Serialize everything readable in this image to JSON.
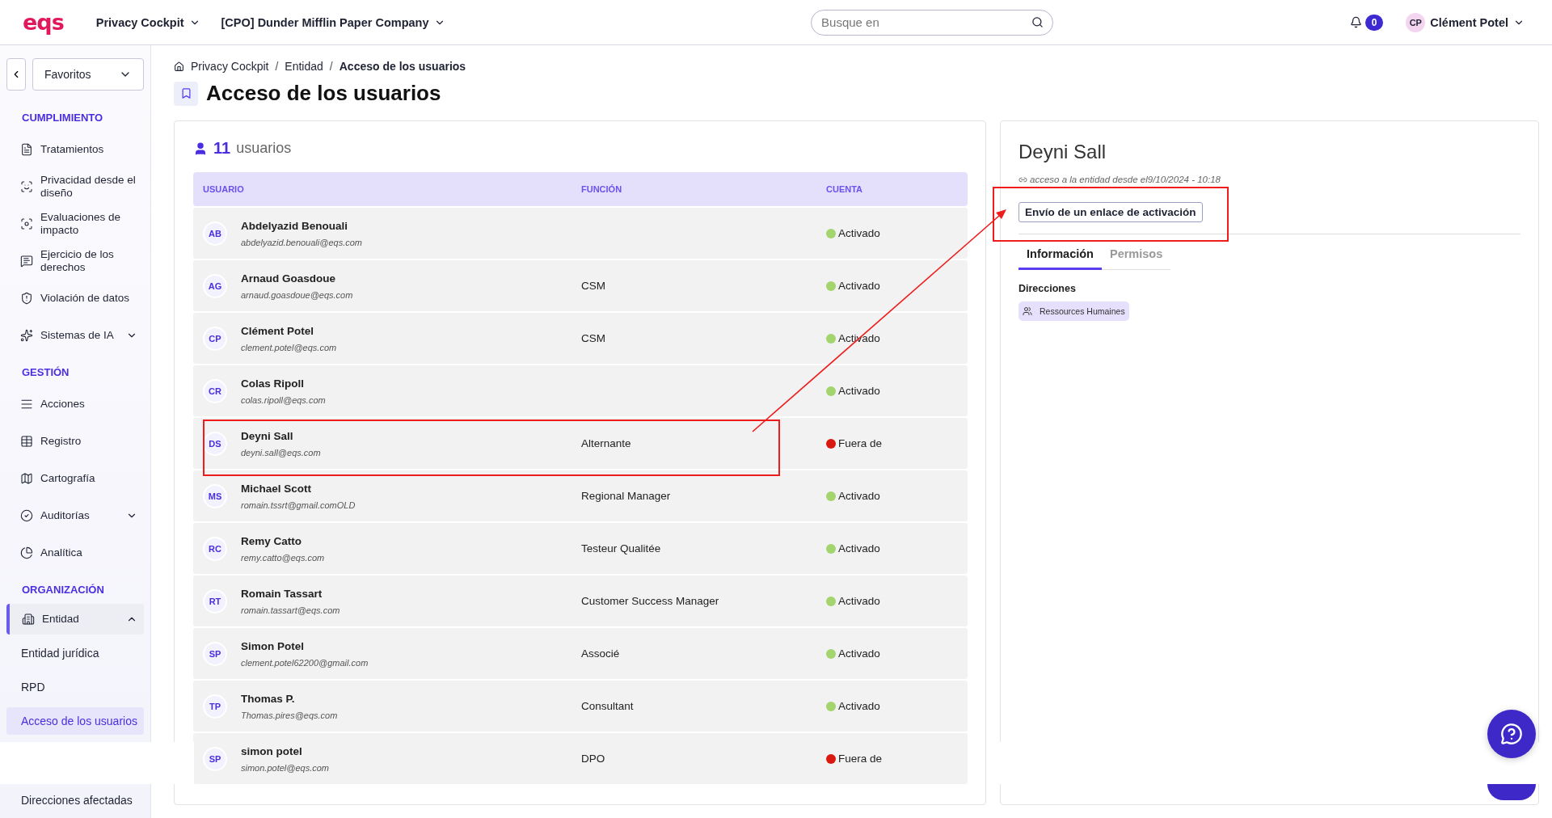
{
  "top_bar": {
    "logo": "eqs",
    "menus": [
      {
        "label": "Privacy Cockpit"
      },
      {
        "label": "[CPO] Dunder Mifflin Paper Company"
      }
    ],
    "search": {
      "placeholder": "Busque en"
    },
    "notifications": "0",
    "user": {
      "initials": "CP",
      "name": "Clément Potel"
    }
  },
  "sidebar": {
    "favorites": "Favoritos",
    "sections": [
      {
        "title": "CUMPLIMIENTO",
        "items": [
          {
            "kind": "link",
            "label": "Tratamientos",
            "selected": false
          },
          {
            "kind": "link",
            "label": "Privacidad desde el diseño",
            "selected": false
          },
          {
            "kind": "link",
            "label": "Evaluaciones de impacto",
            "selected": false
          },
          {
            "kind": "link",
            "label": "Ejercicio de los derechos",
            "selected": false
          },
          {
            "kind": "link",
            "label": "Violación de datos",
            "selected": false
          },
          {
            "kind": "group",
            "label": "Sistemas de IA",
            "selected": false,
            "expanded": false
          }
        ]
      },
      {
        "title": "GESTIÓN",
        "items": [
          {
            "kind": "link",
            "label": "Acciones",
            "selected": false
          },
          {
            "kind": "link",
            "label": "Registro",
            "selected": false
          },
          {
            "kind": "link",
            "label": "Cartografía",
            "selected": false
          },
          {
            "kind": "group",
            "label": "Auditorías",
            "selected": false,
            "expanded": false
          },
          {
            "kind": "link",
            "label": "Analítica",
            "selected": false
          }
        ]
      },
      {
        "title": "ORGANIZACIÓN",
        "items": [
          {
            "kind": "group",
            "label": "Entidad",
            "selected": true,
            "expanded": true,
            "children": [
              {
                "label": "Entidad jurídica",
                "selected": false
              },
              {
                "label": "RPD",
                "selected": false
              },
              {
                "label": "Acceso de los usuarios",
                "selected": true
              },
              {
                "label": "Direcciones afectadas",
                "selected": false
              }
            ]
          }
        ]
      }
    ]
  },
  "breadcrumb": {
    "separator": "/",
    "items": [
      "Privacy Cockpit",
      "Entidad",
      "Acceso de los usuarios"
    ]
  },
  "page_title": "Acceso de los usuarios",
  "users": {
    "count": "11",
    "count_label": "usuarios",
    "columns": [
      "USUARIO",
      "FUNCIÓN",
      "CUENTA"
    ],
    "rows": [
      {
        "initials": "AB",
        "name": "Abdelyazid Benouali",
        "email": "abdelyazid.benouali@eqs.com",
        "status": "Activado",
        "color": "#a3d46e"
      },
      {
        "initials": "AG",
        "name": "Arnaud Goasdoue",
        "email": "arnaud.goasdoue@eqs.com",
        "role": "CSM",
        "status": "Activado",
        "color": "#a3d46e"
      },
      {
        "initials": "CP",
        "name": "Clément Potel",
        "email": "clement.potel@eqs.com",
        "role": "CSM",
        "status": "Activado",
        "color": "#a3d46e"
      },
      {
        "initials": "CR",
        "name": "Colas Ripoll",
        "email": "colas.ripoll@eqs.com",
        "status": "Activado",
        "color": "#a3d46e"
      },
      {
        "initials": "DS",
        "name": "Deyni Sall",
        "email": "deyni.sall@eqs.com",
        "role": "Alternante",
        "status": "Fuera de",
        "color": "#d9190f"
      },
      {
        "initials": "MS",
        "name": "Michael Scott",
        "email": "romain.tssrt@gmail.comOLD",
        "role": "Regional Manager",
        "status": "Activado",
        "color": "#a3d46e"
      },
      {
        "initials": "RC",
        "name": "Remy Catto",
        "email": "remy.catto@eqs.com",
        "role": "Testeur Qualitée",
        "status": "Activado",
        "color": "#a3d46e"
      },
      {
        "initials": "RT",
        "name": "Romain Tassart",
        "email": "romain.tassart@eqs.com",
        "role": "Customer Success Manager",
        "status": "Activado",
        "color": "#a3d46e"
      },
      {
        "initials": "SP",
        "name": "Simon Potel",
        "email": "clement.potel62200@gmail.com",
        "role": "Associé",
        "status": "Activado",
        "color": "#a3d46e"
      },
      {
        "initials": "TP",
        "name": "Thomas P.",
        "email": "Thomas.pires@eqs.com",
        "role": "Consultant",
        "status": "Activado",
        "color": "#a3d46e"
      },
      {
        "initials": "SP",
        "name": "simon potel",
        "email": "simon.potel@eqs.com",
        "role": "DPO",
        "status": "Fuera de",
        "color": "#d9190f"
      }
    ]
  },
  "detail": {
    "name": "Deyni Sall",
    "access_note": "acceso a la entidad desde el9/10/2024 - 10:18",
    "button": "Envío de un enlace de activación",
    "tabs": [
      {
        "label": "Información",
        "selected": true
      },
      {
        "label": "Permisos",
        "selected": false
      }
    ],
    "section_label": "Direcciones",
    "tags": [
      "Ressources Humaines"
    ]
  }
}
